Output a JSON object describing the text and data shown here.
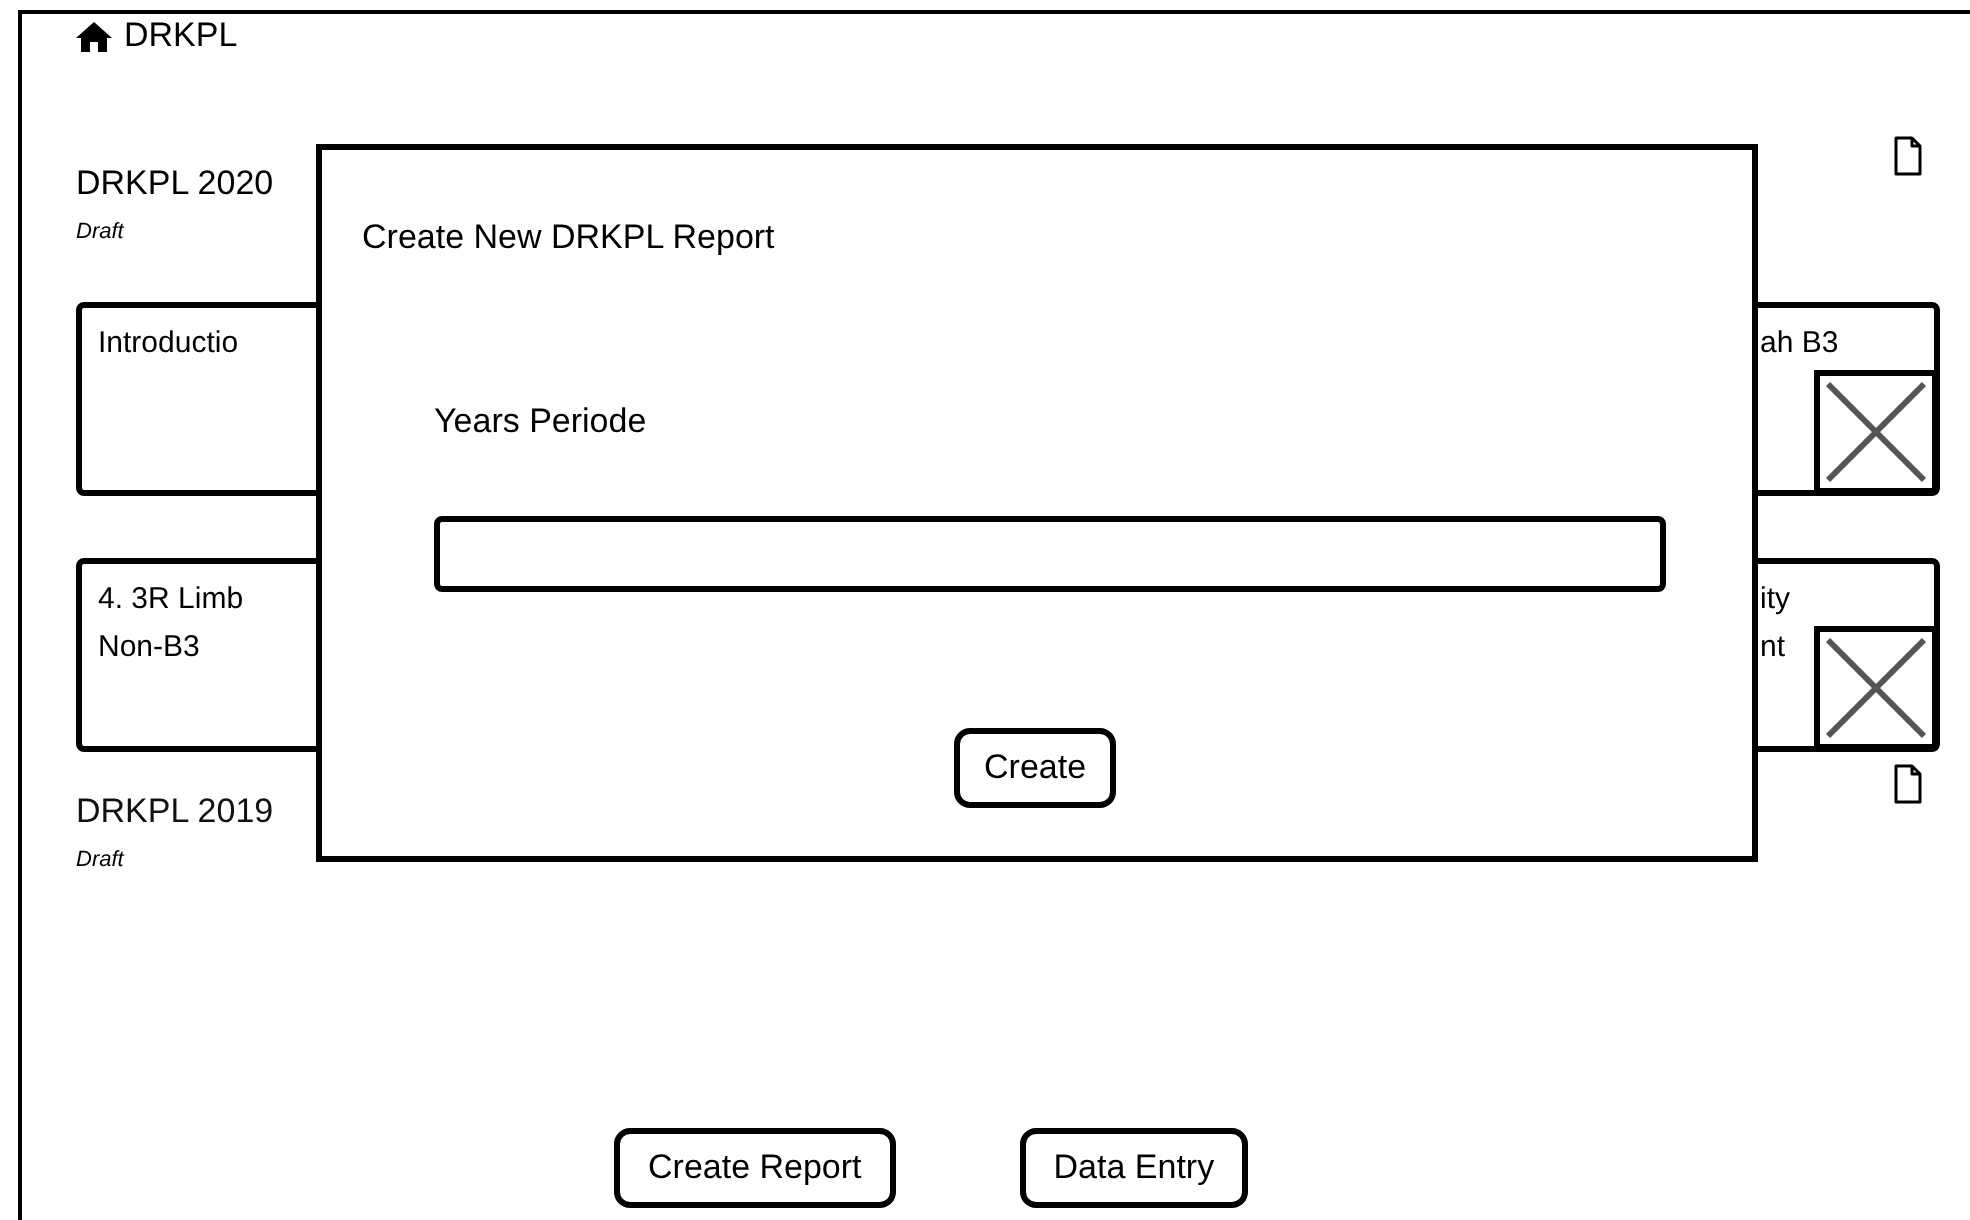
{
  "app": {
    "title": "DRKPL"
  },
  "reports": [
    {
      "title": "DRKPL 2020",
      "status": "Draft",
      "expanded": true,
      "sections": [
        {
          "left_lines": [
            "Introductio"
          ],
          "right_lines": [
            "ah B3"
          ]
        },
        {
          "left_lines": [
            "4. 3R Limb",
            "Non-B3"
          ],
          "right_lines": [
            "ity",
            "nt"
          ]
        }
      ]
    },
    {
      "title": "DRKPL 2019",
      "status": "Draft",
      "expanded": false
    }
  ],
  "dialog": {
    "title": "Create New DRKPL Report",
    "field_label": "Years Periode",
    "button": "Create"
  },
  "buttons": [
    "Create Report",
    "Data Entry"
  ]
}
